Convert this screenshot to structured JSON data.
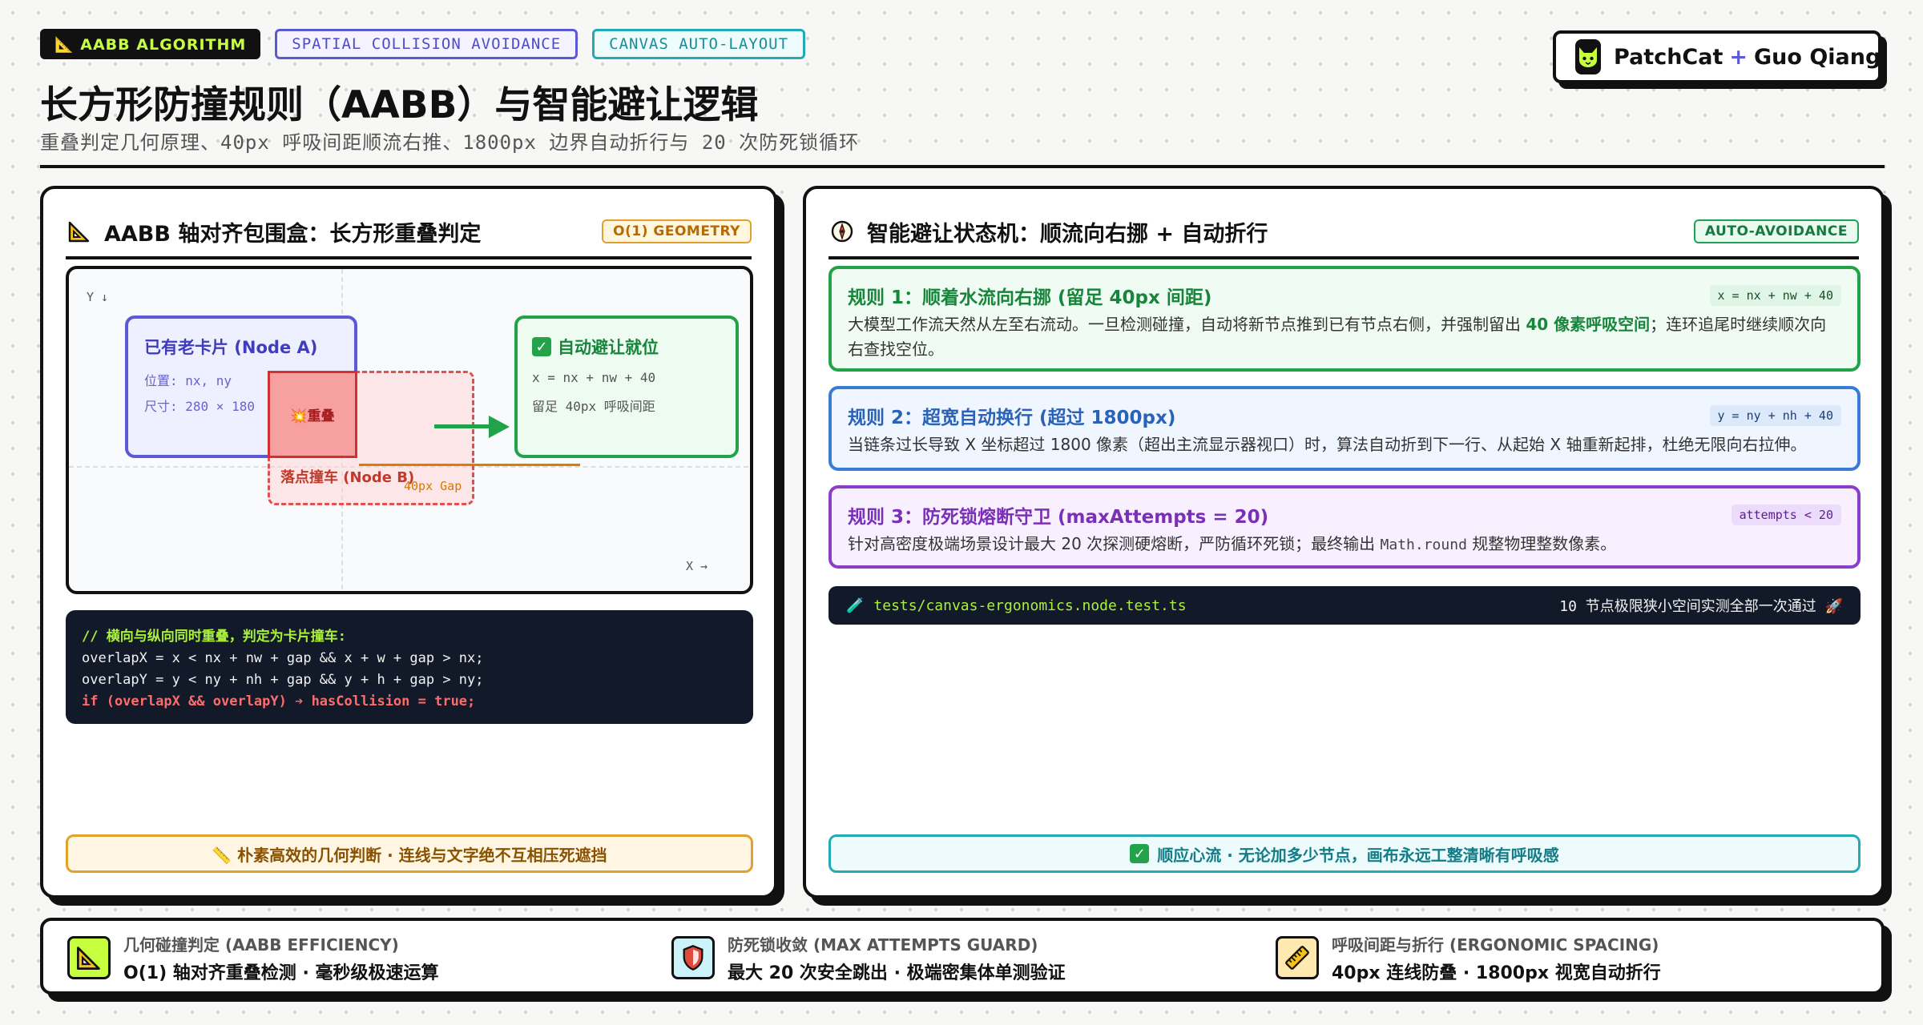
{
  "header": {
    "tags": [
      "📐 AABB ALGORITHM",
      "SPATIAL COLLISION AVOIDANCE",
      "CANVAS AUTO-LAYOUT"
    ],
    "title": "长方形防撞规则（AABB）与智能避让逻辑",
    "subtitle": "重叠判定几何原理、40px 呼吸间距顺流右推、1800px 边界自动折行与 20 次防死锁循环",
    "brand": {
      "name_a": "PatchCat",
      "plus": "+",
      "name_b": "Guo Qiang"
    }
  },
  "left_panel": {
    "title": "AABB 轴对齐包围盒：长方形重叠判定",
    "badge": "O(1) GEOMETRY",
    "diagram": {
      "axis_y": "Y ↓",
      "axis_x": "X →",
      "node_a": {
        "title": "已有老卡片 (Node A)",
        "pos": "位置: nx, ny",
        "size": "尺寸: 280 × 180"
      },
      "overlap_label": "💥重叠",
      "node_b_label": "落点撞车 (Node B)",
      "gap_label": "40px Gap",
      "node_c": {
        "title": "自动避让就位",
        "formula": "x = nx + nw + 40",
        "note": "留足 40px 呼吸间距"
      }
    },
    "code": {
      "comment": "// 横向与纵向同时重叠，判定为卡片撞车:",
      "line1": "overlapX = x < nx + nw + gap && x + w + gap > nx;",
      "line2": "overlapY = y < ny + nh + gap && y + h + gap > ny;",
      "line3": "if (overlapX && overlapY) ➔ hasCollision = true;"
    },
    "footer": "📏 朴素高效的几何判断 · 连线与文字绝不互相压死遮挡"
  },
  "right_panel": {
    "title": "智能避让状态机：顺流向右挪 + 自动折行",
    "badge": "AUTO-AVOIDANCE",
    "rules": [
      {
        "title": "规则 1：顺着水流向右挪 (留足 40px 间距)",
        "formula": "x = nx + nw + 40",
        "desc_pre": "大模型工作流天然从左至右流动。一旦检测碰撞，自动将新节点推到已有节点右侧，并强制留出",
        "desc_bold": "40 像素呼吸空间",
        "desc_post": "；连环追尾时继续顺次向右查找空位。"
      },
      {
        "title": "规则 2：超宽自动换行 (超过 1800px)",
        "formula": "y = ny + nh + 40",
        "desc": "当链条过长导致 X 坐标超过 1800 像素（超出主流显示器视口）时，算法自动折到下一行、从起始 X 轴重新起排，杜绝无限向右拉伸。"
      },
      {
        "title": "规则 3：防死锁熔断守卫 (maxAttempts = 20)",
        "formula": "attempts < 20",
        "desc_pre": "针对高密度极端场景设计最大 20 次探测硬熔断，严防循环死锁；最终输出",
        "desc_code": "Math.round",
        "desc_post": "规整物理整数像素。"
      }
    ],
    "terminal": {
      "icon": "🧪",
      "path": "tests/canvas-ergonomics.node.test.ts",
      "note": "10 节点极限狭小空间实测全部一次通过 🚀"
    },
    "footer": "顺应心流 · 无论加多少节点，画布永远工整清晰有呼吸感"
  },
  "stats": [
    {
      "icon": "triangle-ruler-icon",
      "title": "几何碰撞判定 (AABB EFFICIENCY)",
      "value": "O(1) 轴对齐重叠检测 · 毫秒级极速运算"
    },
    {
      "icon": "shield-icon",
      "title": "防死锁收敛 (MAX ATTEMPTS GUARD)",
      "value": "最大 20 次安全跳出 · 极端密集体单测验证"
    },
    {
      "icon": "ruler-icon",
      "title": "呼吸间距与折行 (ERGONOMIC SPACING)",
      "value": "40px 连线防叠 · 1800px 视宽自动折行"
    }
  ],
  "colors": {
    "accent_lime": "#c6ff3e",
    "purple": "#5b59d6",
    "teal": "#22aab7",
    "green": "#22a34a",
    "blue": "#3a7bd5",
    "violet": "#8b3fc8",
    "red": "#e05050",
    "orange": "#e2a12a"
  }
}
